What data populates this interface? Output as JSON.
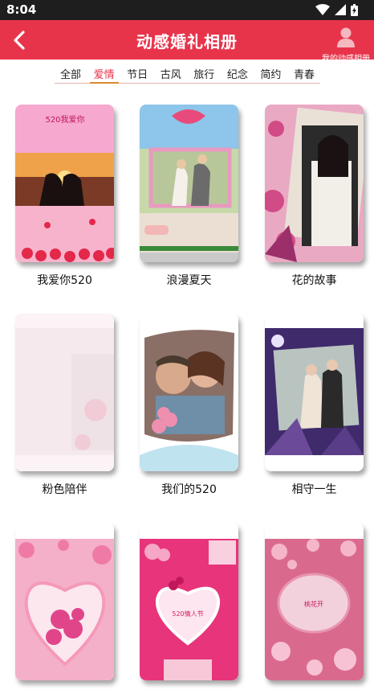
{
  "status": {
    "time": "8:04"
  },
  "appbar": {
    "title": "动感婚礼相册",
    "my_label": "我的动感相册"
  },
  "tabs": [
    {
      "label": "全部",
      "active": false
    },
    {
      "label": "爱情",
      "active": true
    },
    {
      "label": "节日",
      "active": false
    },
    {
      "label": "古风",
      "active": false
    },
    {
      "label": "旅行",
      "active": false
    },
    {
      "label": "纪念",
      "active": false
    },
    {
      "label": "简约",
      "active": false
    },
    {
      "label": "青春",
      "active": false
    }
  ],
  "albums": [
    {
      "title": "我爱你520",
      "thumb_text": "520我爱你"
    },
    {
      "title": "浪漫夏天",
      "thumb_text": ""
    },
    {
      "title": "花的故事",
      "thumb_text": ""
    },
    {
      "title": "粉色陪伴",
      "thumb_text": ""
    },
    {
      "title": "我们的520",
      "thumb_text": ""
    },
    {
      "title": "相守一生",
      "thumb_text": ""
    },
    {
      "title": "",
      "thumb_text": ""
    },
    {
      "title": "",
      "thumb_text": "520情人节"
    },
    {
      "title": "",
      "thumb_text": "桃花开"
    }
  ],
  "colors": {
    "appbar": "#e8344b",
    "active_tab": "#e8344b",
    "tab_underline": "#d98a2b"
  }
}
